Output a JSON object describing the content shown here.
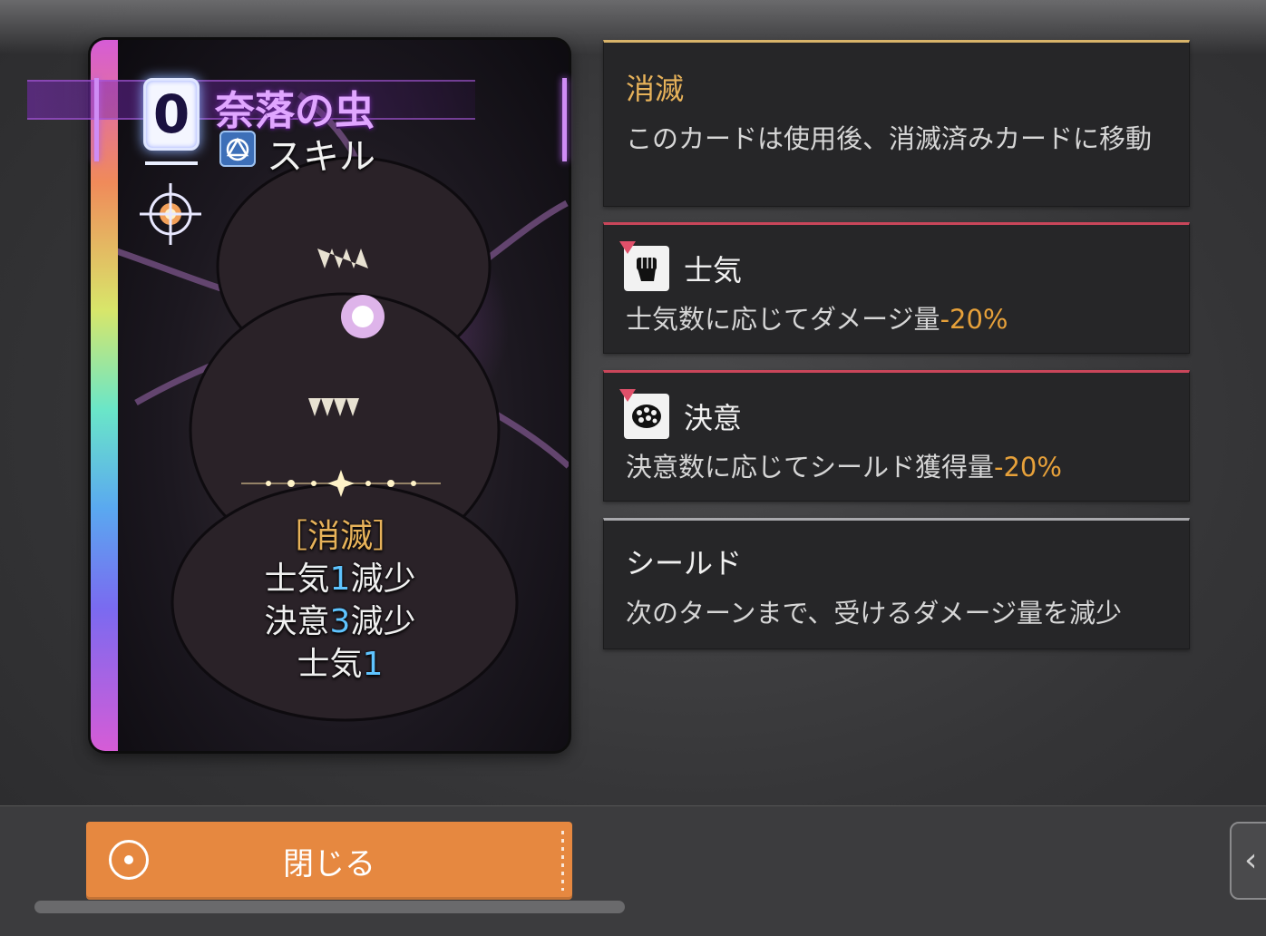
{
  "card": {
    "cost": "0",
    "name": "奈落の虫",
    "type_icon": "skill-type-icon",
    "type": "スキル",
    "target_icon": "target-crosshair-icon",
    "text": {
      "keyword": "［消滅］",
      "line1_pre": "士気",
      "line1_num": "1",
      "line1_post": "減少",
      "line2_pre": "決意",
      "line2_num": "3",
      "line2_post": "減少",
      "line3_pre": "士気",
      "line3_num": "1"
    }
  },
  "panels": {
    "exhaust": {
      "title": "消滅",
      "desc": "このカードは使用後、消滅済みカードに移動"
    },
    "morale": {
      "icon": "fist-icon",
      "title": "士気",
      "desc_pre": "士気数に応じてダメージ量",
      "desc_value": "-20%"
    },
    "resolve": {
      "icon": "pinecone-icon",
      "title": "決意",
      "desc_pre": "決意数に応じてシールド獲得量",
      "desc_value": "-20%"
    },
    "shield": {
      "title": "シールド",
      "desc": "次のターンまで、受けるダメージ量を減少"
    }
  },
  "bottom": {
    "close_label": "閉じる",
    "close_icon": "circle-dot-icon",
    "side_tab_icon": "chevron-left-icon"
  },
  "colors": {
    "keyword_gold": "#e7b25a",
    "number_blue": "#5fc4ff",
    "debuff_red": "#c9465a",
    "button_orange": "#e68840"
  }
}
